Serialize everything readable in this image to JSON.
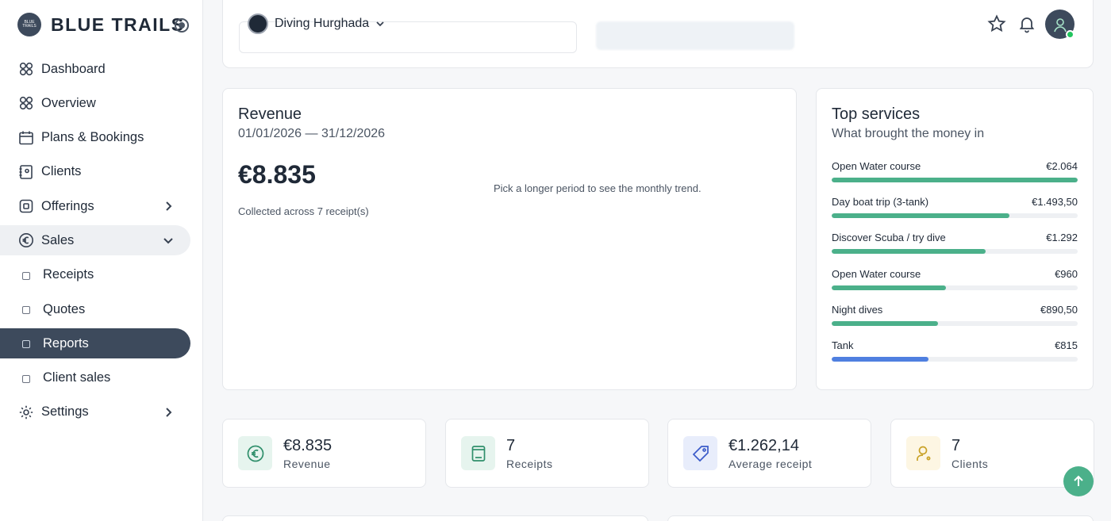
{
  "brand": {
    "name": "BLUE TRAILS",
    "logo_text": "BLUE TRAILS"
  },
  "sidebar": {
    "items": [
      {
        "label": "Dashboard",
        "icon": "grid-icon"
      },
      {
        "label": "Overview",
        "icon": "grid-icon"
      },
      {
        "label": "Plans & Bookings",
        "icon": "calendar-icon"
      },
      {
        "label": "Clients",
        "icon": "contacts-icon"
      },
      {
        "label": "Offerings",
        "icon": "box-icon"
      },
      {
        "label": "Sales",
        "icon": "euro-circle-icon"
      },
      {
        "label": "Receipts",
        "icon": "square-icon"
      },
      {
        "label": "Quotes",
        "icon": "square-icon"
      },
      {
        "label": "Reports",
        "icon": "square-icon"
      },
      {
        "label": "Client sales",
        "icon": "square-icon"
      },
      {
        "label": "Settings",
        "icon": "gear-icon"
      }
    ]
  },
  "topbar": {
    "company": "Diving Hurghada"
  },
  "revenue": {
    "title": "Revenue",
    "range": "01/01/2026 — 31/12/2026",
    "amount": "€8.835",
    "note": "Pick a longer period to see the monthly trend.",
    "collected": "Collected across 7 receipt(s)"
  },
  "top_services": {
    "title": "Top services",
    "subtitle": "What brought the money in",
    "items": [
      {
        "name": "Open Water course",
        "value": "€2.064",
        "share": 1.0,
        "color": "#4bb08a"
      },
      {
        "name": "Day boat trip (3-tank)",
        "value": "€1.493,50",
        "share": 0.723,
        "color": "#4bb08a"
      },
      {
        "name": "Discover Scuba / try dive",
        "value": "€1.292",
        "share": 0.626,
        "color": "#4bb08a"
      },
      {
        "name": "Open Water course",
        "value": "€960",
        "share": 0.465,
        "color": "#4bb08a"
      },
      {
        "name": "Night dives",
        "value": "€890,50",
        "share": 0.431,
        "color": "#4bb08a"
      },
      {
        "name": "Tank",
        "value": "€815",
        "share": 0.395,
        "color": "#4f7fe0"
      }
    ]
  },
  "stats": [
    {
      "value": "€8.835",
      "label": "Revenue",
      "icon": "euro-icon",
      "bg": "#e6f4ee",
      "color": "#2f8f6b"
    },
    {
      "value": "7",
      "label": "Receipts",
      "icon": "receipt-icon",
      "bg": "#e6f4ee",
      "color": "#2f8f6b"
    },
    {
      "value": "€1.262,14",
      "label": "Average receipt",
      "icon": "tag-icon",
      "bg": "#e8edfb",
      "color": "#3b5bc9"
    },
    {
      "value": "7",
      "label": "Clients",
      "icon": "user-icon",
      "bg": "#fdf6e3",
      "color": "#c9a227"
    }
  ],
  "colors": {
    "accent": "#4bb08a",
    "sidebar_active": "#3d4a5c"
  }
}
